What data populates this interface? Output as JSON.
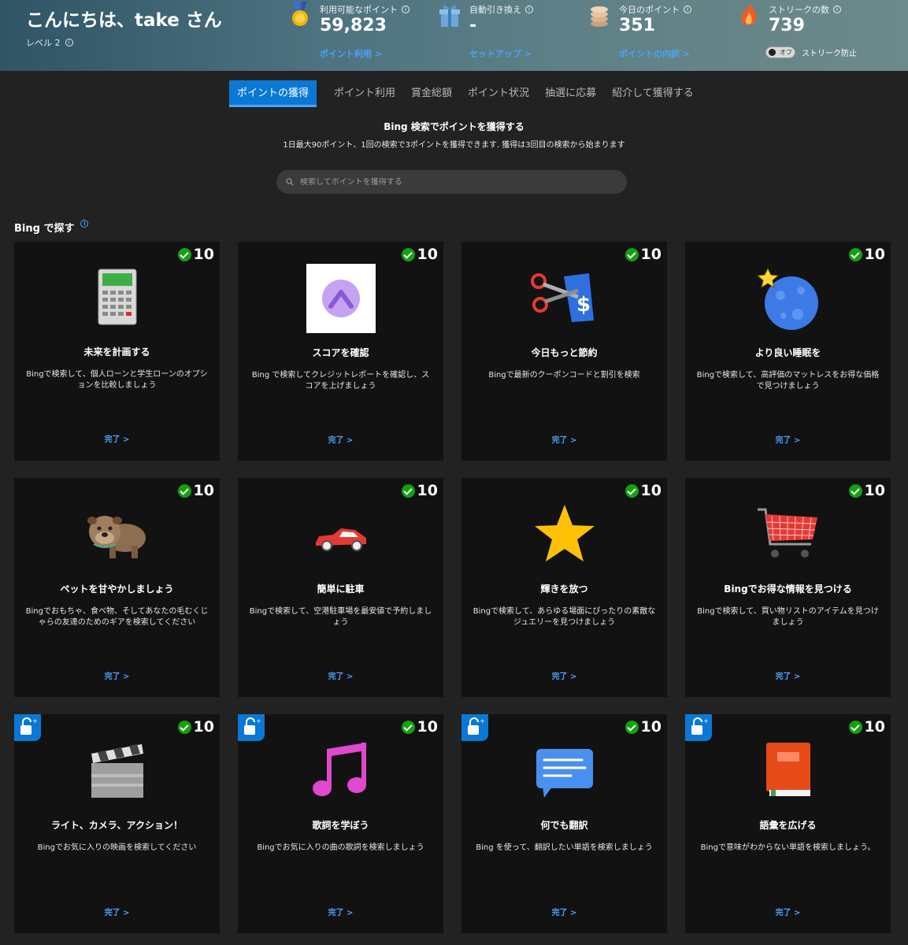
{
  "header": {
    "greeting": "こんにちは、take さん",
    "level": "レベル 2",
    "stats": [
      {
        "label": "利用可能なポイント",
        "value": "59,823",
        "link": "ポイント利用 >",
        "icon": "medal-icon"
      },
      {
        "label": "自動引き換え",
        "value": "-",
        "link": "セットアップ >",
        "icon": "gift-box-icon"
      },
      {
        "label": "今日のポイント",
        "value": "351",
        "link": "ポイントの内訳 >",
        "icon": "coins-stack-icon"
      },
      {
        "label": "ストリークの数",
        "value": "739",
        "icon": "flame-icon"
      }
    ],
    "streak_toggle_state": "オフ",
    "streak_protect_label": "ストリーク防止"
  },
  "tabs": [
    "ポイントの獲得",
    "ポイント利用",
    "賞金総額",
    "ポイント状況",
    "抽選に応募",
    "紹介して獲得する"
  ],
  "active_tab": 0,
  "search_section": {
    "title": "Bing 検索でポイントを獲得する",
    "subtitle": "1日最大90ポイント、1回の検索で3ポイントを獲得できます. 獲得は3回目の検索から始まります",
    "placeholder": "検索してポイントを獲得する"
  },
  "explore": {
    "title": "Bing で探す",
    "cards": [
      {
        "title": "未来を計画する",
        "desc": "Bingで検索して、個人ローンと学生ローンのオプションを比較しましょう",
        "points": "10",
        "link": "完了 >",
        "icon": "calculator-icon",
        "locked": false
      },
      {
        "title": "スコアを確認",
        "desc": "Bing で検索してクレジットレポートを確認し、スコアを上げましょう",
        "points": "10",
        "link": "完了 >",
        "icon": "score-gauge-icon",
        "locked": false
      },
      {
        "title": "今日もっと節約",
        "desc": "Bingで最新のクーポンコードと割引を検索",
        "points": "10",
        "link": "完了 >",
        "icon": "coupon-scissors-icon",
        "locked": false
      },
      {
        "title": "より良い睡眠を",
        "desc": "Bingで検索して、高評価のマットレスをお得な価格で見つけましょう",
        "points": "10",
        "link": "完了 >",
        "icon": "moon-star-icon",
        "locked": false
      },
      {
        "title": "ペットを甘やかしましょう",
        "desc": "Bingでおもちゃ、食べ物、そしてあなたの毛むくじゃらの友達のためのギアを検索してください",
        "points": "10",
        "link": "完了 >",
        "icon": "bulldog-icon",
        "locked": false
      },
      {
        "title": "簡単に駐車",
        "desc": "Bingで検索して、空港駐車場を最安値で予約しましょう",
        "points": "10",
        "link": "完了 >",
        "icon": "red-car-icon",
        "locked": false
      },
      {
        "title": "輝きを放つ",
        "desc": "Bingで検索して、あらゆる場面にぴったりの素敵なジュエリーを見つけましょう",
        "points": "10",
        "link": "完了 >",
        "icon": "star-icon",
        "locked": false
      },
      {
        "title": "Bingでお得な情報を見つける",
        "desc": "Bingで検索して、買い物リストのアイテムを見つけましょう",
        "points": "10",
        "link": "完了 >",
        "icon": "shopping-cart-icon",
        "locked": false
      },
      {
        "title": "ライト、カメラ、アクション！",
        "desc": "Bingでお気に入りの映画を検索してください",
        "points": "10",
        "link": "完了 >",
        "icon": "clapperboard-icon",
        "locked": true
      },
      {
        "title": "歌詞を学ぼう",
        "desc": "Bingでお気に入りの曲の歌詞を検索しましょう",
        "points": "10",
        "link": "完了 >",
        "icon": "music-note-icon",
        "locked": true
      },
      {
        "title": "何でも翻訳",
        "desc": "Bing を使って、翻訳したい単語を検索しましょう",
        "points": "10",
        "link": "完了 >",
        "icon": "chat-bubble-icon",
        "locked": true
      },
      {
        "title": "語彙を広げる",
        "desc": "Bingで意味がわからない単語を検索しましょう。",
        "points": "10",
        "link": "完了 >",
        "icon": "book-icon",
        "locked": true
      }
    ]
  },
  "colors": {
    "accent": "#0a78d4",
    "link": "#4aa3ff",
    "check": "#13a10e",
    "card_bg": "#121212",
    "page_bg": "#222222"
  }
}
